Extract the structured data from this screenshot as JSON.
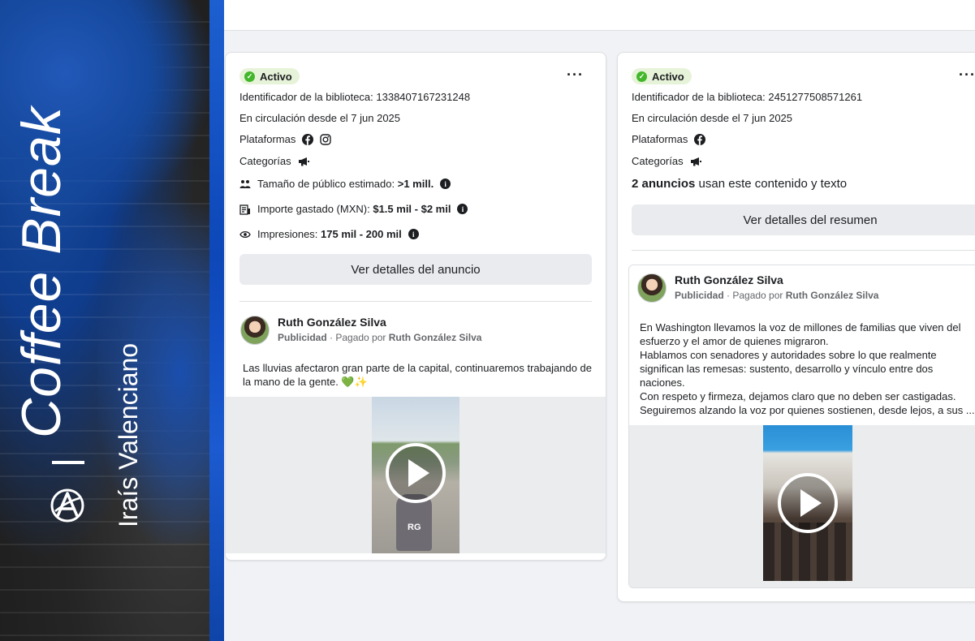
{
  "banner": {
    "title": "Coffee Break",
    "author": "Iraís Valenciano",
    "logo": "circled-a-logo"
  },
  "cards": [
    {
      "status": "Activo",
      "more_label": "···",
      "library_id": "Identificador de la biblioteca: 1338407167231248",
      "since": "En circulación desde el 7 jun 2025",
      "platforms_label": "Plataformas",
      "platform_icons": [
        "facebook-icon",
        "instagram-icon"
      ],
      "categories_label": "Categorías",
      "audience_label": "Tamaño de público estimado:",
      "audience_value": ">1 mill.",
      "spend_label": "Importe gastado (MXN):",
      "spend_value": "$1.5 mil - $2 mil",
      "impressions_label": "Impresiones:",
      "impressions_value": "175 mil - 200 mil",
      "button": "Ver detalles del anuncio",
      "post": {
        "name": "Ruth González Silva",
        "sub_bold": "Publicidad",
        "sub_text": " · Pagado por ",
        "sub_payer": "Ruth González Silva",
        "text": "Las lluvias afectaron gran parte de la capital, continuaremos trabajando de la mano de la gente. 💚✨",
        "video_badge": "RG"
      }
    },
    {
      "status": "Activo",
      "more_label": "···",
      "library_id": "Identificador de la biblioteca: 2451277508571261",
      "since": "En circulación desde el 7 jun 2025",
      "platforms_label": "Plataformas",
      "platform_icons": [
        "facebook-icon"
      ],
      "categories_label": "Categorías",
      "ads_count_bold": "2 anuncios",
      "ads_count_text": " usan este contenido y texto",
      "button": "Ver detalles del resumen",
      "post": {
        "name": "Ruth González Silva",
        "sub_bold": "Publicidad",
        "sub_text": " · Pagado por ",
        "sub_payer": "Ruth González Silva",
        "text_lines": [
          "En Washington llevamos la voz de millones de familias que viven del esfuerzo y el amor de quienes migraron.",
          "Hablamos con senadores y autoridades sobre lo que realmente significan las remesas: sustento, desarrollo y vínculo entre dos naciones.",
          "Con respeto y firmeza, dejamos claro que no deben ser castigadas.",
          "Seguiremos alzando la voz por quienes sostienen, desde lejos, a sus ..."
        ]
      }
    }
  ]
}
